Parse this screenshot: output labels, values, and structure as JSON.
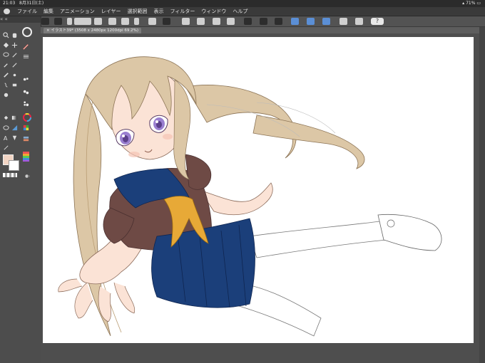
{
  "status": {
    "time": "21:03",
    "date": "8月31日(土)",
    "battery": "71%"
  },
  "menu": {
    "items": [
      "ファイル",
      "編集",
      "アニメーション",
      "レイヤー",
      "選択範囲",
      "表示",
      "フィルター",
      "ウィンドウ",
      "ヘルプ"
    ]
  },
  "toolbar": {
    "help_label": "?"
  },
  "panel": {
    "header": "«  «"
  },
  "document": {
    "tab_title": "× イラスト39* (3508 x 2480px 1200dpi 69.2%)"
  },
  "colors": {
    "main_color": "#f2d5c4",
    "sub_color": "#ffffff",
    "hair": "#dcc7a6",
    "skin": "#fbe3d6",
    "uniform": "#6e4a45",
    "skirt": "#1b3f7a",
    "scarf": "#e7a937",
    "eyes": "#9a7fd0"
  },
  "icons": {
    "menu_logo": "clip-studio-logo-icon",
    "navigation": "navigator-icon",
    "undo": "undo-icon",
    "redo": "redo-icon",
    "help": "help-icon"
  }
}
